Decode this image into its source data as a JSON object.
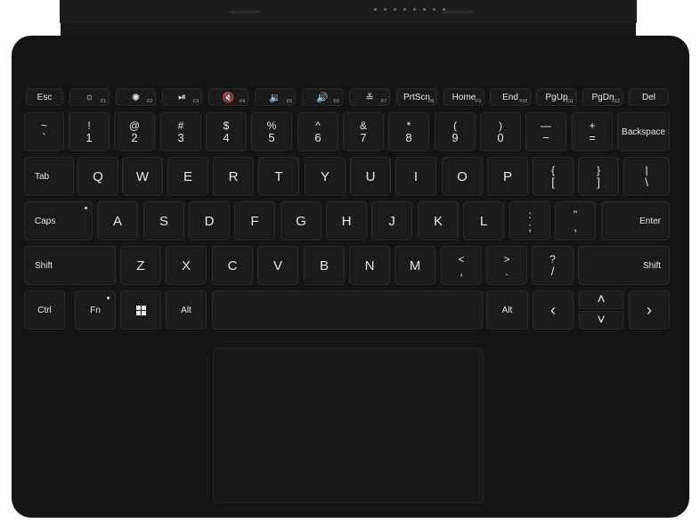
{
  "function_row": [
    {
      "label": "Esc"
    },
    {
      "icon": "brightness-down-icon",
      "glyph": "☼",
      "fn": "F1"
    },
    {
      "icon": "brightness-up-icon",
      "glyph": "✺",
      "fn": "F2"
    },
    {
      "icon": "play-pause-icon",
      "glyph": "⏯",
      "fn": "F3"
    },
    {
      "icon": "mute-icon",
      "glyph": "🔇",
      "fn": "F4"
    },
    {
      "icon": "volume-down-icon",
      "glyph": "🔉",
      "fn": "F5"
    },
    {
      "icon": "volume-up-icon",
      "glyph": "🔊",
      "fn": "F6"
    },
    {
      "icon": "backlight-icon",
      "glyph": "≚",
      "fn": "F7"
    },
    {
      "label": "PrtScn",
      "fn": "F8"
    },
    {
      "label": "Home",
      "fn": "F9"
    },
    {
      "label": "End",
      "fn": "F10"
    },
    {
      "label": "PgUp",
      "fn": "F11"
    },
    {
      "label": "PgDn",
      "fn": "F12"
    },
    {
      "label": "Del"
    }
  ],
  "number_row": [
    {
      "top": "~",
      "bottom": "`"
    },
    {
      "top": "!",
      "bottom": "1"
    },
    {
      "top": "@",
      "bottom": "2"
    },
    {
      "top": "#",
      "bottom": "3"
    },
    {
      "top": "$",
      "bottom": "4"
    },
    {
      "top": "%",
      "bottom": "5"
    },
    {
      "top": "^",
      "bottom": "6"
    },
    {
      "top": "&",
      "bottom": "7"
    },
    {
      "top": "*",
      "bottom": "8"
    },
    {
      "top": "(",
      "bottom": "9"
    },
    {
      "top": ")",
      "bottom": "0"
    },
    {
      "top": "—",
      "bottom": "−"
    },
    {
      "top": "+",
      "bottom": "="
    },
    {
      "label": "Backspace"
    }
  ],
  "q_row": [
    {
      "label": "Tab"
    },
    {
      "label": "Q"
    },
    {
      "label": "W"
    },
    {
      "label": "E"
    },
    {
      "label": "R"
    },
    {
      "label": "T"
    },
    {
      "label": "Y"
    },
    {
      "label": "U"
    },
    {
      "label": "I"
    },
    {
      "label": "O"
    },
    {
      "label": "P"
    },
    {
      "top": "{",
      "bottom": "["
    },
    {
      "top": "}",
      "bottom": "]"
    },
    {
      "top": "|",
      "bottom": "\\"
    }
  ],
  "a_row": [
    {
      "label": "Caps"
    },
    {
      "label": "A"
    },
    {
      "label": "S"
    },
    {
      "label": "D"
    },
    {
      "label": "F"
    },
    {
      "label": "G"
    },
    {
      "label": "H"
    },
    {
      "label": "J"
    },
    {
      "label": "K"
    },
    {
      "label": "L"
    },
    {
      "top": ":",
      "bottom": ";"
    },
    {
      "top": "\"",
      "bottom": ","
    },
    {
      "label": "Enter"
    }
  ],
  "z_row": [
    {
      "label": "Shift"
    },
    {
      "label": "Z"
    },
    {
      "label": "X"
    },
    {
      "label": "C"
    },
    {
      "label": "V"
    },
    {
      "label": "B"
    },
    {
      "label": "N"
    },
    {
      "label": "M"
    },
    {
      "top": "<",
      "bottom": ","
    },
    {
      "top": ">",
      "bottom": "."
    },
    {
      "top": "?",
      "bottom": "/"
    },
    {
      "label": "Shift"
    }
  ],
  "bottom_row": [
    {
      "label": "Ctrl"
    },
    {
      "label": "Fn"
    },
    {
      "icon": "windows-logo-icon"
    },
    {
      "label": "Alt"
    },
    {
      "label": ""
    },
    {
      "label": "Alt"
    },
    {
      "icon": "arrow-left-icon",
      "glyph": "‹"
    },
    {
      "icon": "arrow-up-icon",
      "glyph": "˄"
    },
    {
      "icon": "arrow-down-icon",
      "glyph": "˅"
    },
    {
      "icon": "arrow-right-icon",
      "glyph": "›"
    }
  ]
}
